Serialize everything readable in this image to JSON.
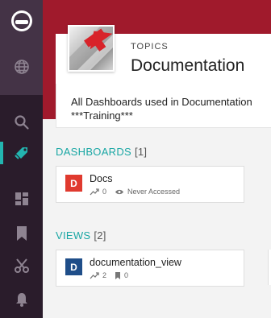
{
  "topic": {
    "type_label": "TOPICS",
    "title": "Documentation",
    "description_line1": "All Dashboards used in Documentation",
    "description_line2": "***Training***"
  },
  "dashboards": {
    "heading": "DASHBOARDS",
    "count": "[1]",
    "items": [
      {
        "badge": "D",
        "badge_color": "#e03a2f",
        "name": "Docs",
        "trend_value": "0",
        "access_text": "Never Accessed"
      }
    ]
  },
  "views": {
    "heading": "VIEWS",
    "count": "[2]",
    "items": [
      {
        "badge": "D",
        "badge_color": "#1f4e89",
        "name": "documentation_view",
        "trend_value": "2",
        "bookmark_value": "0"
      }
    ]
  },
  "sidebar": {
    "icons": [
      "app-logo-icon",
      "globe-icon",
      "search-icon",
      "tag-icon",
      "dashboard-grid-icon",
      "bookmark-icon",
      "scissors-icon",
      "bell-icon"
    ],
    "active": "tag-icon"
  },
  "colors": {
    "accent": "#1aa7a4",
    "header_red": "#a01a2c",
    "sidebar_dark": "#2a1c2b"
  }
}
